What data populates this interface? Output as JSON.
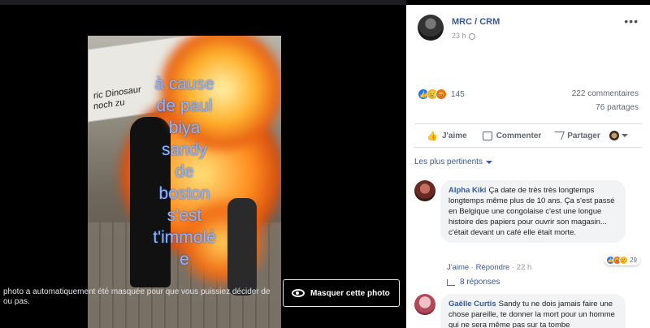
{
  "viewer": {
    "photo_caption": [
      "à cause",
      "de paul",
      "biya",
      "sandy",
      "de",
      "boston",
      "s'est",
      "t'immolé",
      "e"
    ],
    "banner_text": "ric Dinosaur\nnoch zu",
    "alt_note": "photo a automatiquement été masquée pour que vous puissiez décider de ou pas.",
    "mask_button": "Masquer cette photo",
    "mask_icon": "eye-icon"
  },
  "post": {
    "page_name": "MRC / CRM",
    "time": "23 h",
    "more_icon": "•••",
    "reactions": {
      "count": "145",
      "types": [
        "like",
        "sad",
        "angry"
      ]
    },
    "comments_count": "222 commentaires",
    "shares_count": "76 partages",
    "actions": {
      "like": "J'aime",
      "comment": "Commenter",
      "share": "Partager"
    },
    "relevance_label": "Les plus pertinents"
  },
  "comments": [
    {
      "author": "Alpha Kiki",
      "text": "Ça date de très très longtemps longtemps même plus de 10 ans. Ça s'est passé en Belgique une congolaise c'est une longue histoire des papiers pour ouvrir son magasin... c'était devant un café elle était morte.",
      "like_label": "J'aime",
      "reply_label": "Répondre",
      "age": "22 h",
      "reaction_count": "29",
      "replies_label": "8 réponses"
    },
    {
      "author": "Gaëlle Curtis",
      "text": "Sandy tu ne dois jamais faire une chose pareille, te donner la mort pour un homme qui ne sera même pas sur ta tombe"
    }
  ],
  "colors": {
    "link": "#385898",
    "caption": "#8fb4ff",
    "like_blue": "#1877f2"
  }
}
